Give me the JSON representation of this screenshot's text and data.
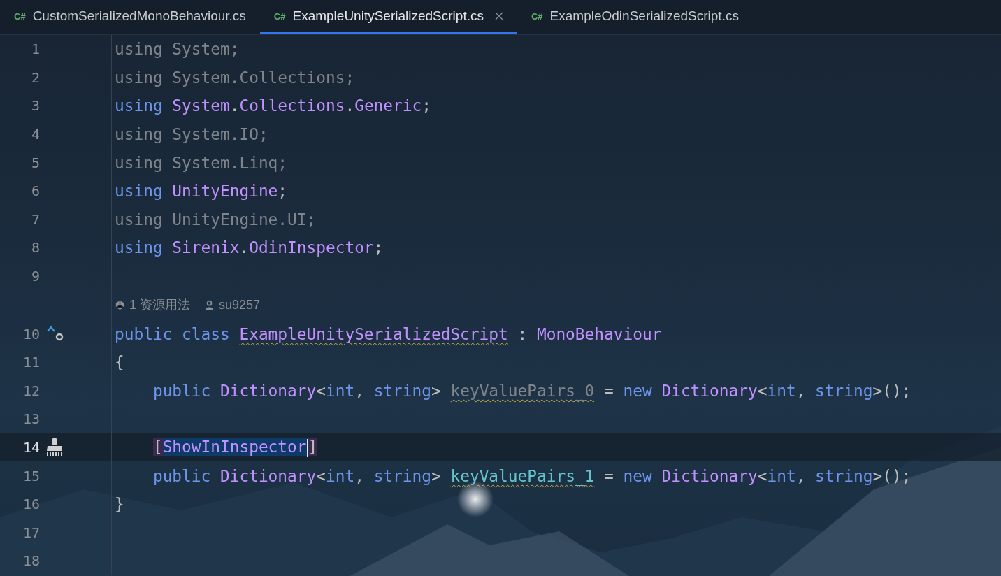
{
  "tabs": [
    {
      "lang": "C#",
      "label": "CustomSerializedMonoBehaviour.cs",
      "selected": false,
      "closable": false
    },
    {
      "lang": "C#",
      "label": "ExampleUnitySerializedScript.cs",
      "selected": true,
      "closable": true
    },
    {
      "lang": "C#",
      "label": "ExampleOdinSerializedScript.cs",
      "selected": false,
      "closable": false
    }
  ],
  "lines": [
    {
      "number": "1",
      "current": false,
      "tokens": [
        {
          "t": "using",
          "kind": "dim"
        },
        {
          "t": " System;",
          "kind": "dim"
        }
      ]
    },
    {
      "number": "2",
      "current": false,
      "tokens": [
        {
          "t": "using",
          "kind": "dim"
        },
        {
          "t": " System.Collections;",
          "kind": "dim"
        }
      ]
    },
    {
      "number": "3",
      "current": false,
      "tokens": [
        {
          "t": "using",
          "kind": "kw"
        },
        {
          "t": " System",
          "kind": "type"
        },
        {
          "t": ".",
          "kind": "plain"
        },
        {
          "t": "Collections",
          "kind": "type"
        },
        {
          "t": ".",
          "kind": "plain"
        },
        {
          "t": "Generic",
          "kind": "type"
        },
        {
          "t": ";",
          "kind": "plain"
        }
      ]
    },
    {
      "number": "4",
      "current": false,
      "tokens": [
        {
          "t": "using",
          "kind": "dim"
        },
        {
          "t": " System.IO;",
          "kind": "dim"
        }
      ]
    },
    {
      "number": "5",
      "current": false,
      "tokens": [
        {
          "t": "using",
          "kind": "dim"
        },
        {
          "t": " System.Linq;",
          "kind": "dim"
        }
      ]
    },
    {
      "number": "6",
      "current": false,
      "tokens": [
        {
          "t": "using",
          "kind": "kw"
        },
        {
          "t": " UnityEngine",
          "kind": "type"
        },
        {
          "t": ";",
          "kind": "plain"
        }
      ]
    },
    {
      "number": "7",
      "current": false,
      "tokens": [
        {
          "t": "using",
          "kind": "dim"
        },
        {
          "t": " UnityEngine.UI;",
          "kind": "dim"
        }
      ]
    },
    {
      "number": "8",
      "current": false,
      "tokens": [
        {
          "t": "using",
          "kind": "kw"
        },
        {
          "t": " Sirenix",
          "kind": "type"
        },
        {
          "t": ".",
          "kind": "plain"
        },
        {
          "t": "OdinInspector",
          "kind": "type"
        },
        {
          "t": ";",
          "kind": "plain"
        }
      ]
    },
    {
      "number": "9",
      "current": false
    },
    {
      "number": "10",
      "current": false,
      "code_lens": {
        "usages": "1 资源用法",
        "author": "su9257"
      },
      "gutter": {
        "kind": "implements"
      },
      "tokens": [
        {
          "t": "public class",
          "kind": "kw"
        },
        {
          "t": " ExampleUnitySerializedScript",
          "kind": "type",
          "warn": true
        },
        {
          "t": " :",
          "kind": "plain"
        },
        {
          "t": " MonoBehaviour",
          "kind": "type"
        }
      ]
    },
    {
      "number": "11",
      "current": false,
      "tokens": [
        {
          "t": "{",
          "kind": "plain"
        }
      ]
    },
    {
      "number": "12",
      "current": false,
      "tokens": [
        {
          "t": "    public",
          "kind": "kw"
        },
        {
          "t": " Dictionary",
          "kind": "type"
        },
        {
          "t": "<",
          "kind": "plain"
        },
        {
          "t": "int",
          "kind": "kw"
        },
        {
          "t": ",",
          "kind": "plain"
        },
        {
          "t": " string",
          "kind": "kw"
        },
        {
          "t": ">",
          "kind": "plain"
        },
        {
          "t": " keyValuePairs_0",
          "kind": "dim",
          "warn": true
        },
        {
          "t": " =",
          "kind": "plain"
        },
        {
          "t": " new",
          "kind": "kw"
        },
        {
          "t": " Dictionary",
          "kind": "type"
        },
        {
          "t": "<",
          "kind": "plain"
        },
        {
          "t": "int",
          "kind": "kw"
        },
        {
          "t": ",",
          "kind": "plain"
        },
        {
          "t": " string",
          "kind": "kw"
        },
        {
          "t": ">();",
          "kind": "plain"
        }
      ]
    },
    {
      "number": "13",
      "current": false
    },
    {
      "number": "14",
      "current": true,
      "gutter": {
        "kind": "brush"
      },
      "tokens": [
        {
          "t": "    [",
          "kind": "plain",
          "match": true
        },
        {
          "t": "ShowInInspector",
          "kind": "type",
          "selected": true,
          "caret": true
        },
        {
          "t": "]",
          "kind": "plain",
          "match": true
        }
      ]
    },
    {
      "number": "15",
      "current": false,
      "tokens": [
        {
          "t": "    public",
          "kind": "kw"
        },
        {
          "t": " Dictionary",
          "kind": "type"
        },
        {
          "t": "<",
          "kind": "plain"
        },
        {
          "t": "int",
          "kind": "kw"
        },
        {
          "t": ",",
          "kind": "plain"
        },
        {
          "t": " string",
          "kind": "kw"
        },
        {
          "t": ">",
          "kind": "plain"
        },
        {
          "t": " keyValuePairs_1",
          "kind": "field",
          "warn": true
        },
        {
          "t": " =",
          "kind": "plain"
        },
        {
          "t": " new",
          "kind": "kw"
        },
        {
          "t": " Dictionary",
          "kind": "type"
        },
        {
          "t": "<",
          "kind": "plain"
        },
        {
          "t": "int",
          "kind": "kw"
        },
        {
          "t": ",",
          "kind": "plain"
        },
        {
          "t": " string",
          "kind": "kw"
        },
        {
          "t": ">();",
          "kind": "plain"
        }
      ]
    },
    {
      "number": "16",
      "current": false,
      "tokens": [
        {
          "t": "}",
          "kind": "plain"
        }
      ]
    },
    {
      "number": "17",
      "current": false
    },
    {
      "number": "18",
      "current": false
    }
  ]
}
